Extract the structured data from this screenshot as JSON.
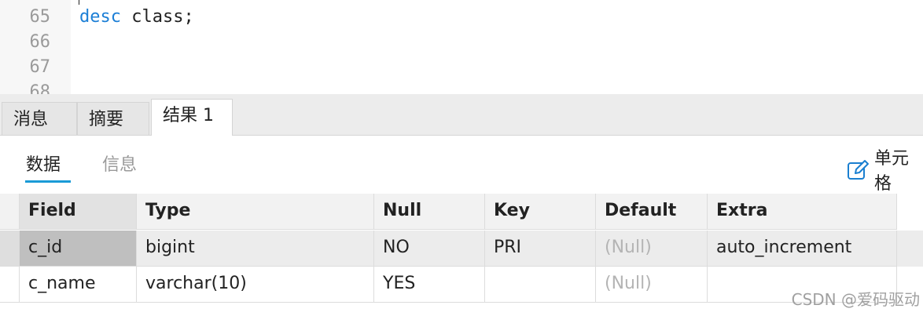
{
  "editor": {
    "lines": [
      {
        "no": "65",
        "keyword": "desc",
        "rest": " class;"
      },
      {
        "no": "66",
        "keyword": "",
        "rest": ""
      },
      {
        "no": "67",
        "keyword": "",
        "rest": ""
      },
      {
        "no": "68",
        "keyword": "",
        "rest": ""
      }
    ]
  },
  "tabs": [
    {
      "label": "消息"
    },
    {
      "label": "摘要"
    },
    {
      "label": "结果 1",
      "active": true
    }
  ],
  "subtabs": [
    {
      "label": "数据",
      "active": true
    },
    {
      "label": "信息"
    }
  ],
  "toolbar": {
    "cell_edit_label": "单元格",
    "cell_edit_icon": "pencil-edit-icon"
  },
  "grid": {
    "columns": [
      "Field",
      "Type",
      "Null",
      "Key",
      "Default",
      "Extra"
    ],
    "rows": [
      [
        "c_id",
        "bigint",
        "NO",
        "PRI",
        "(Null)",
        "auto_increment"
      ],
      [
        "c_name",
        "varchar(10)",
        "YES",
        "",
        "(Null)",
        ""
      ]
    ]
  },
  "watermark": "CSDN @爱码驱动",
  "colors": {
    "keyword": "#1c7fd6",
    "tab_underline": "#1a9ad6",
    "null_text": "#b4b4b4",
    "selected_cell": "#bfbfbf"
  }
}
